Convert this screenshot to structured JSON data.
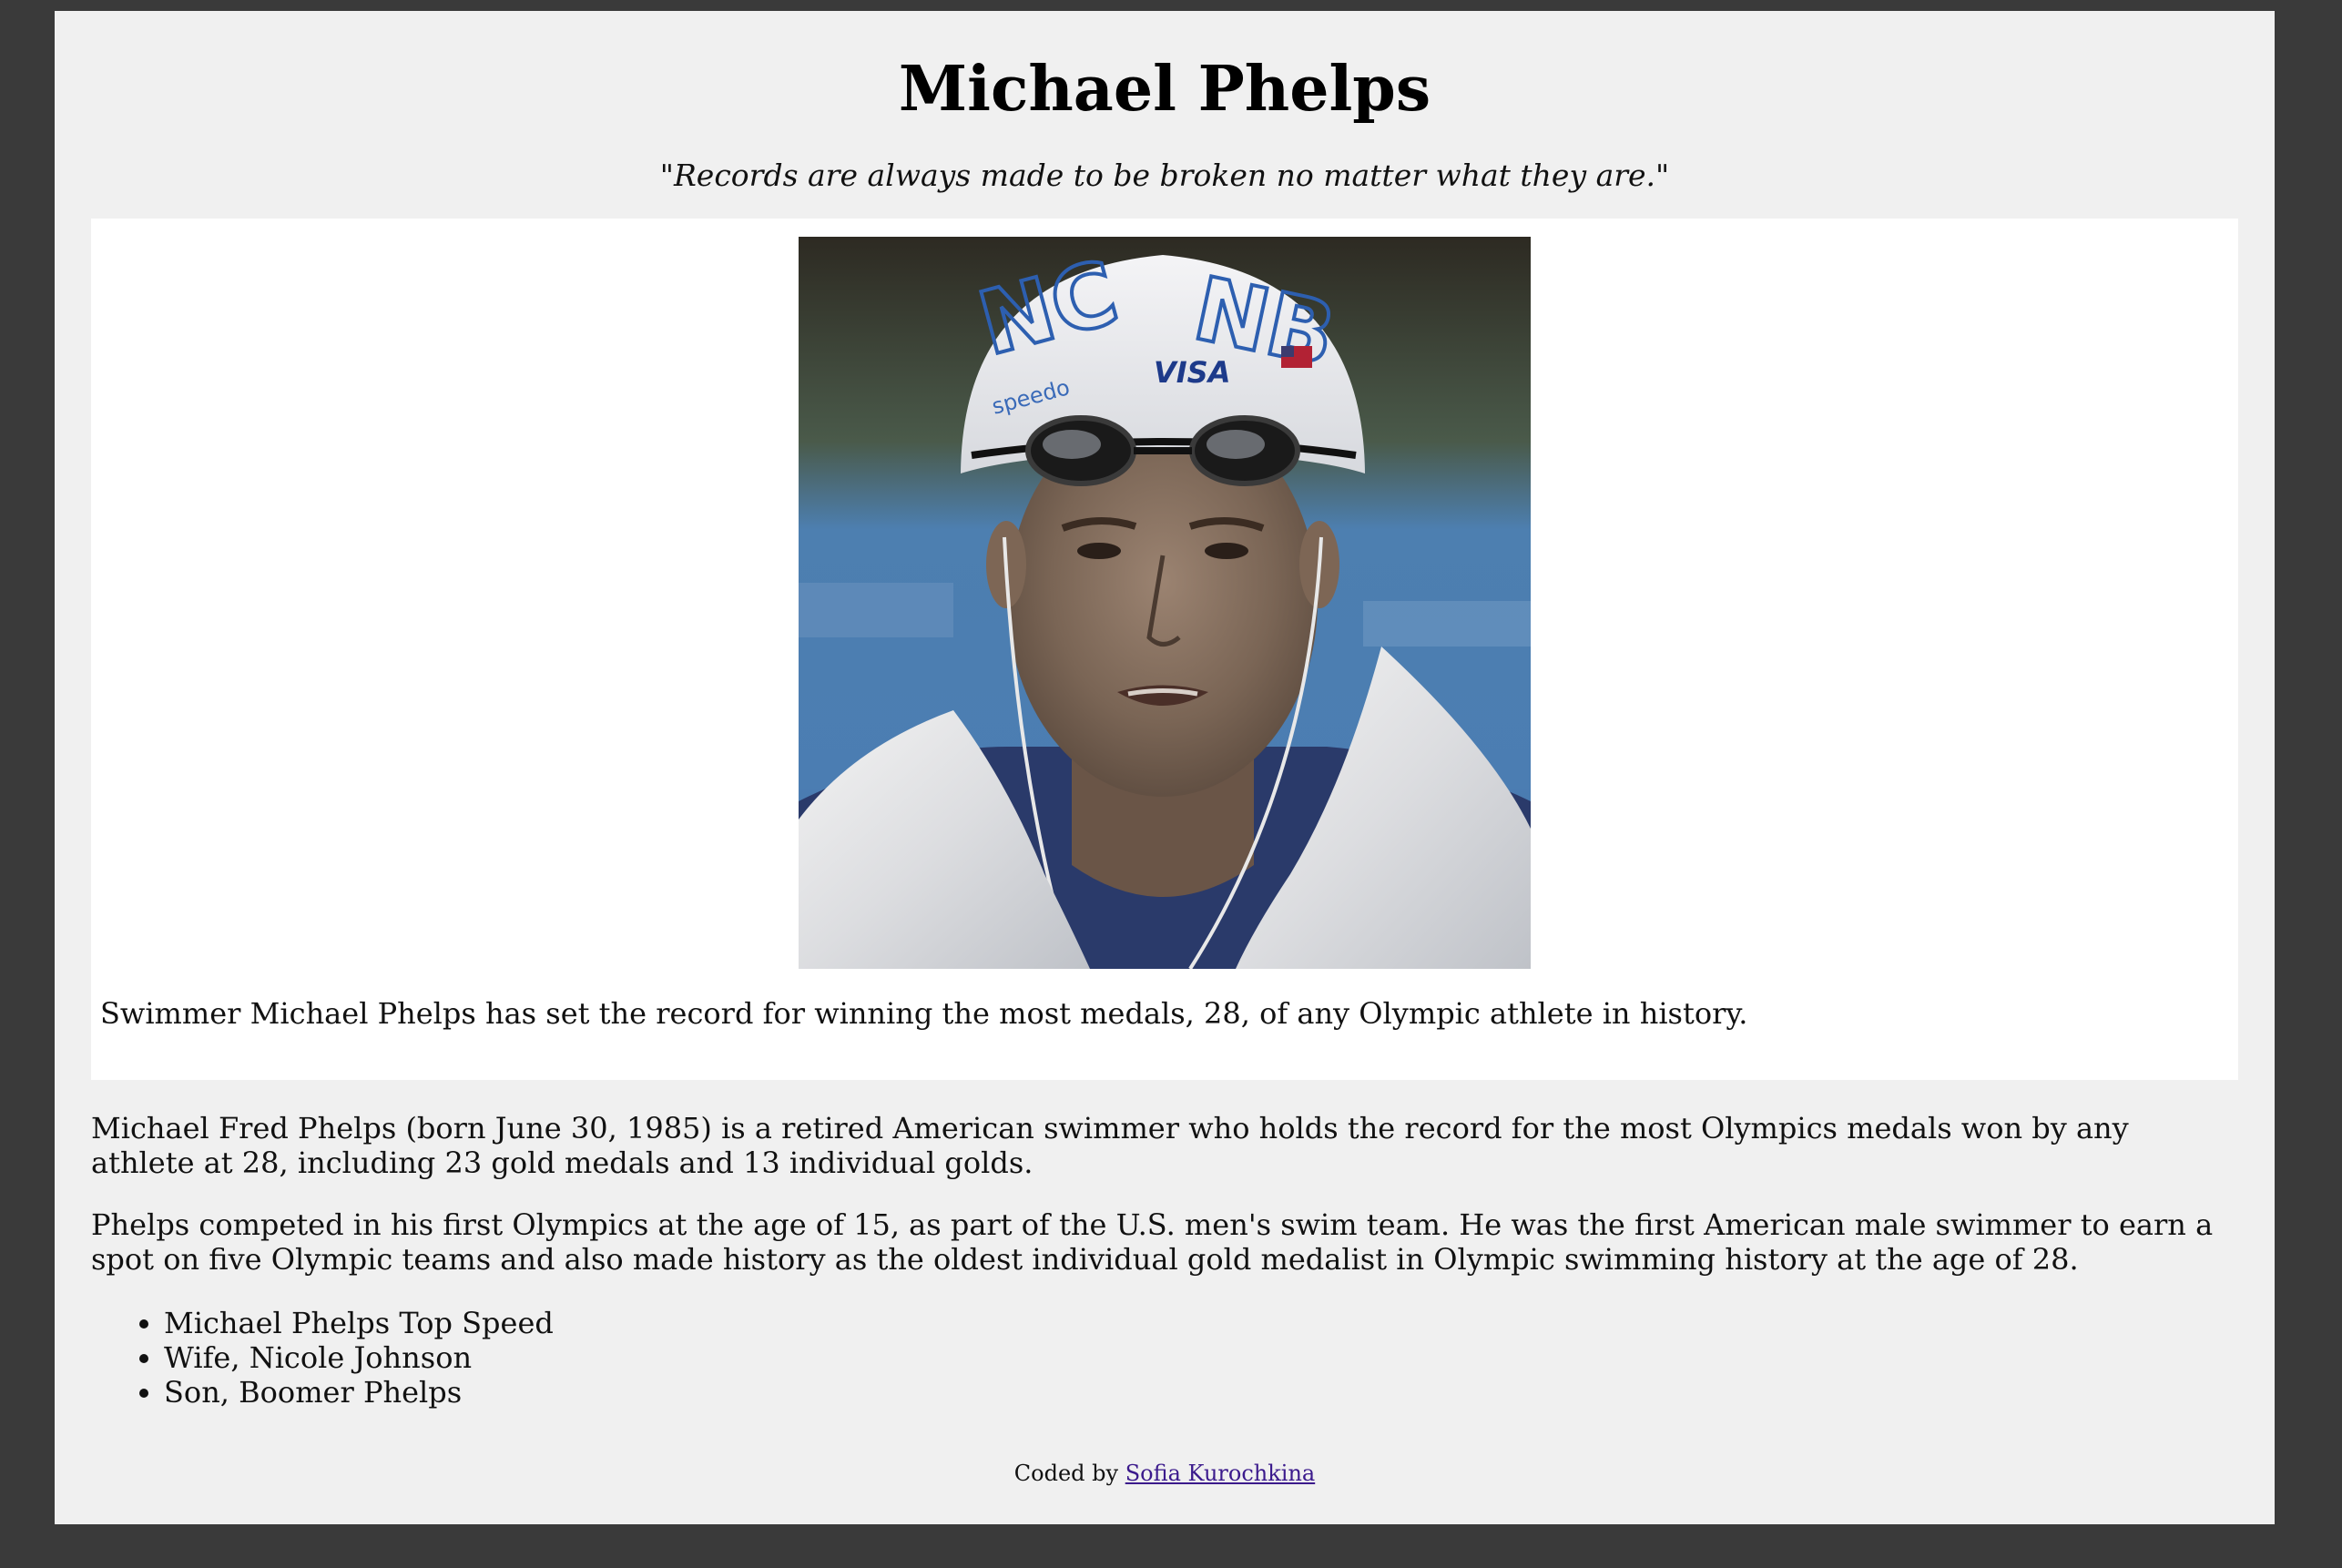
{
  "page": {
    "title": "Michael Phelps",
    "quote": "\"Records are always made to be broken no matter what they are.\""
  },
  "image": {
    "alt": "Michael Phelps in swim cap and goggles with a towel",
    "caption": "Swimmer Michael Phelps has set the record for winning the most medals, 28, of any Olympic athlete in history.",
    "cap_text_left": "NC",
    "cap_text_right": "NB",
    "cap_brand": "speedo",
    "cap_sponsor": "VISA"
  },
  "bio": {
    "paragraph1": "Michael Fred Phelps (born June 30, 1985) is a retired American swimmer who holds the record for the most Olympics medals won by any athlete at 28, including 23 gold medals and 13 individual golds.",
    "paragraph2": "Phelps competed in his first Olympics at the age of 15, as part of the U.S. men's swim team. He was the first American male swimmer to earn a spot on five Olympic teams and also made history as the oldest individual gold medalist in Olympic swimming history at the age of 28."
  },
  "facts": [
    "Michael Phelps Top Speed",
    "Wife, Nicole Johnson",
    "Son, Boomer Phelps"
  ],
  "footer": {
    "prefix": "Coded by",
    "author": "Sofia Kurochkina"
  },
  "colors": {
    "page_bg": "#3a3a3a",
    "panel_bg": "#f0f0f0",
    "image_box_bg": "#ffffff",
    "link": "#3b1a8c"
  }
}
